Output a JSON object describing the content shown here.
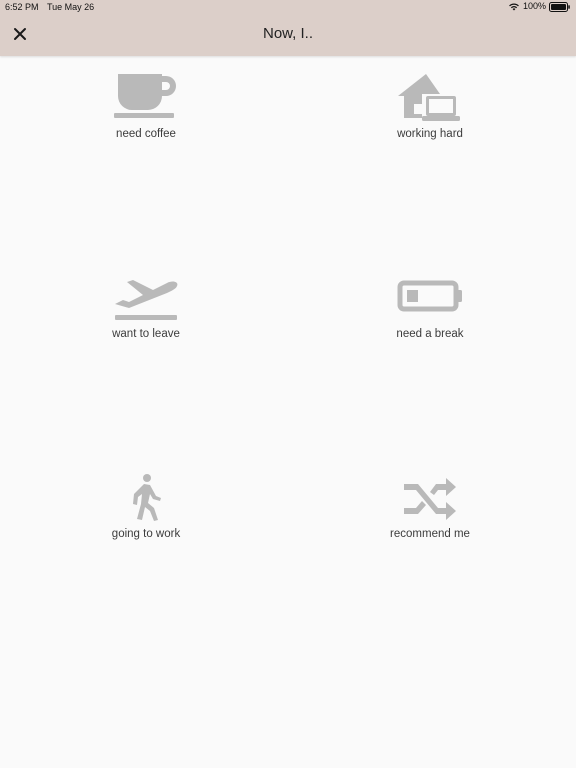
{
  "status_bar": {
    "time": "6:52 PM",
    "date": "Tue May 26",
    "battery": "100%"
  },
  "header": {
    "title": "Now, I.."
  },
  "tiles": [
    {
      "label": "need coffee",
      "icon": "coffee-icon"
    },
    {
      "label": "working hard",
      "icon": "house-laptop-icon"
    },
    {
      "label": "want to leave",
      "icon": "airplane-takeoff-icon"
    },
    {
      "label": "need a break",
      "icon": "battery-low-icon"
    },
    {
      "label": "going to work",
      "icon": "walking-person-icon"
    },
    {
      "label": "recommend me",
      "icon": "shuffle-icon"
    }
  ],
  "colors": {
    "header_bg": "#dccfc9",
    "page_bg": "#fafafa",
    "icon_gray": "#b9b9b9"
  }
}
